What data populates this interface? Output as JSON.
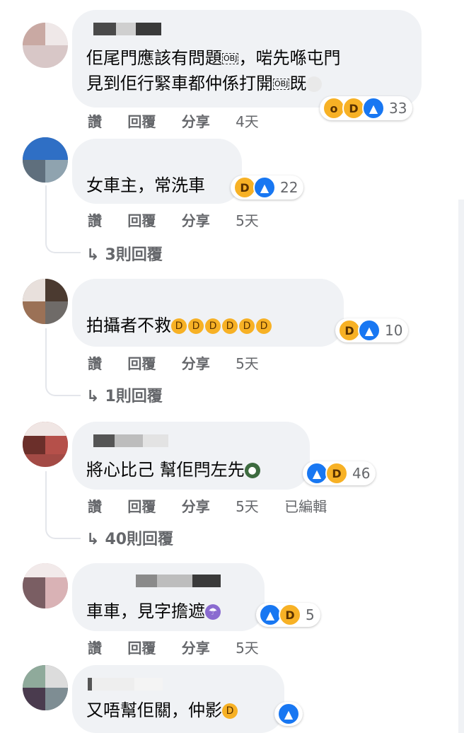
{
  "comments": [
    {
      "text_lines": [
        "佢尾門應該有問題",
        "，啱先喺屯門",
        "見到佢行緊車都仲係打開",
        "既"
      ],
      "obj_label": "OBJ",
      "reaction_count": "33",
      "actions": {
        "like": "讚",
        "reply": "回覆",
        "share": "分享",
        "time": "4天"
      }
    },
    {
      "text": "女車主，常洗車",
      "reaction_count": "22",
      "actions": {
        "like": "讚",
        "reply": "回覆",
        "share": "分享",
        "time": "5天"
      },
      "replies": "3則回覆"
    },
    {
      "text": "拍攝者不救",
      "reaction_count": "10",
      "actions": {
        "like": "讚",
        "reply": "回覆",
        "share": "分享",
        "time": "5天"
      },
      "replies": "1則回覆"
    },
    {
      "text": "將心比己 幫佢閂左先",
      "reaction_count": "46",
      "actions": {
        "like": "讚",
        "reply": "回覆",
        "share": "分享",
        "time": "5天",
        "edited": "已編輯"
      },
      "replies": "40則回覆"
    },
    {
      "text": "車車，見字擔遮",
      "reaction_count": "5",
      "actions": {
        "like": "讚",
        "reply": "回覆",
        "share": "分享",
        "time": "5天"
      }
    },
    {
      "text": "又唔幫佢關，仲影"
    }
  ],
  "colors": {
    "bubble": "#f0f2f5",
    "like": "#1877f2",
    "haha": "#f7b125",
    "meta": "#65676b"
  }
}
